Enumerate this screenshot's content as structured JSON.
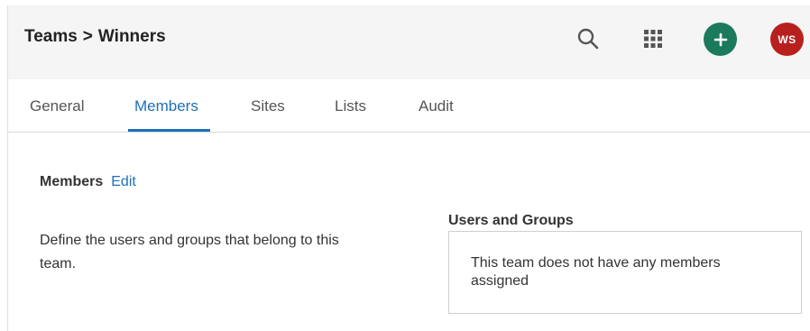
{
  "header": {
    "breadcrumb": {
      "parent": "Teams",
      "separator": ">",
      "current": "Winners"
    },
    "icons": {
      "search": "search-icon",
      "apps": "apps-grid-icon",
      "add": "plus-icon"
    },
    "avatar_initials": "WS",
    "colors": {
      "header_bg": "#f5f5f5",
      "add_button": "#1b7a5c",
      "avatar": "#b8201e"
    }
  },
  "tabs": [
    {
      "label": "General",
      "active": false
    },
    {
      "label": "Members",
      "active": true
    },
    {
      "label": "Sites",
      "active": false
    },
    {
      "label": "Lists",
      "active": false
    },
    {
      "label": "Audit",
      "active": false
    }
  ],
  "members": {
    "title": "Members",
    "edit_label": "Edit",
    "description": "Define the users and groups that belong to this team.",
    "users_groups_title": "Users and Groups",
    "empty_message": "This team does not have any members assigned"
  },
  "accent_color": "#1d6fb8"
}
